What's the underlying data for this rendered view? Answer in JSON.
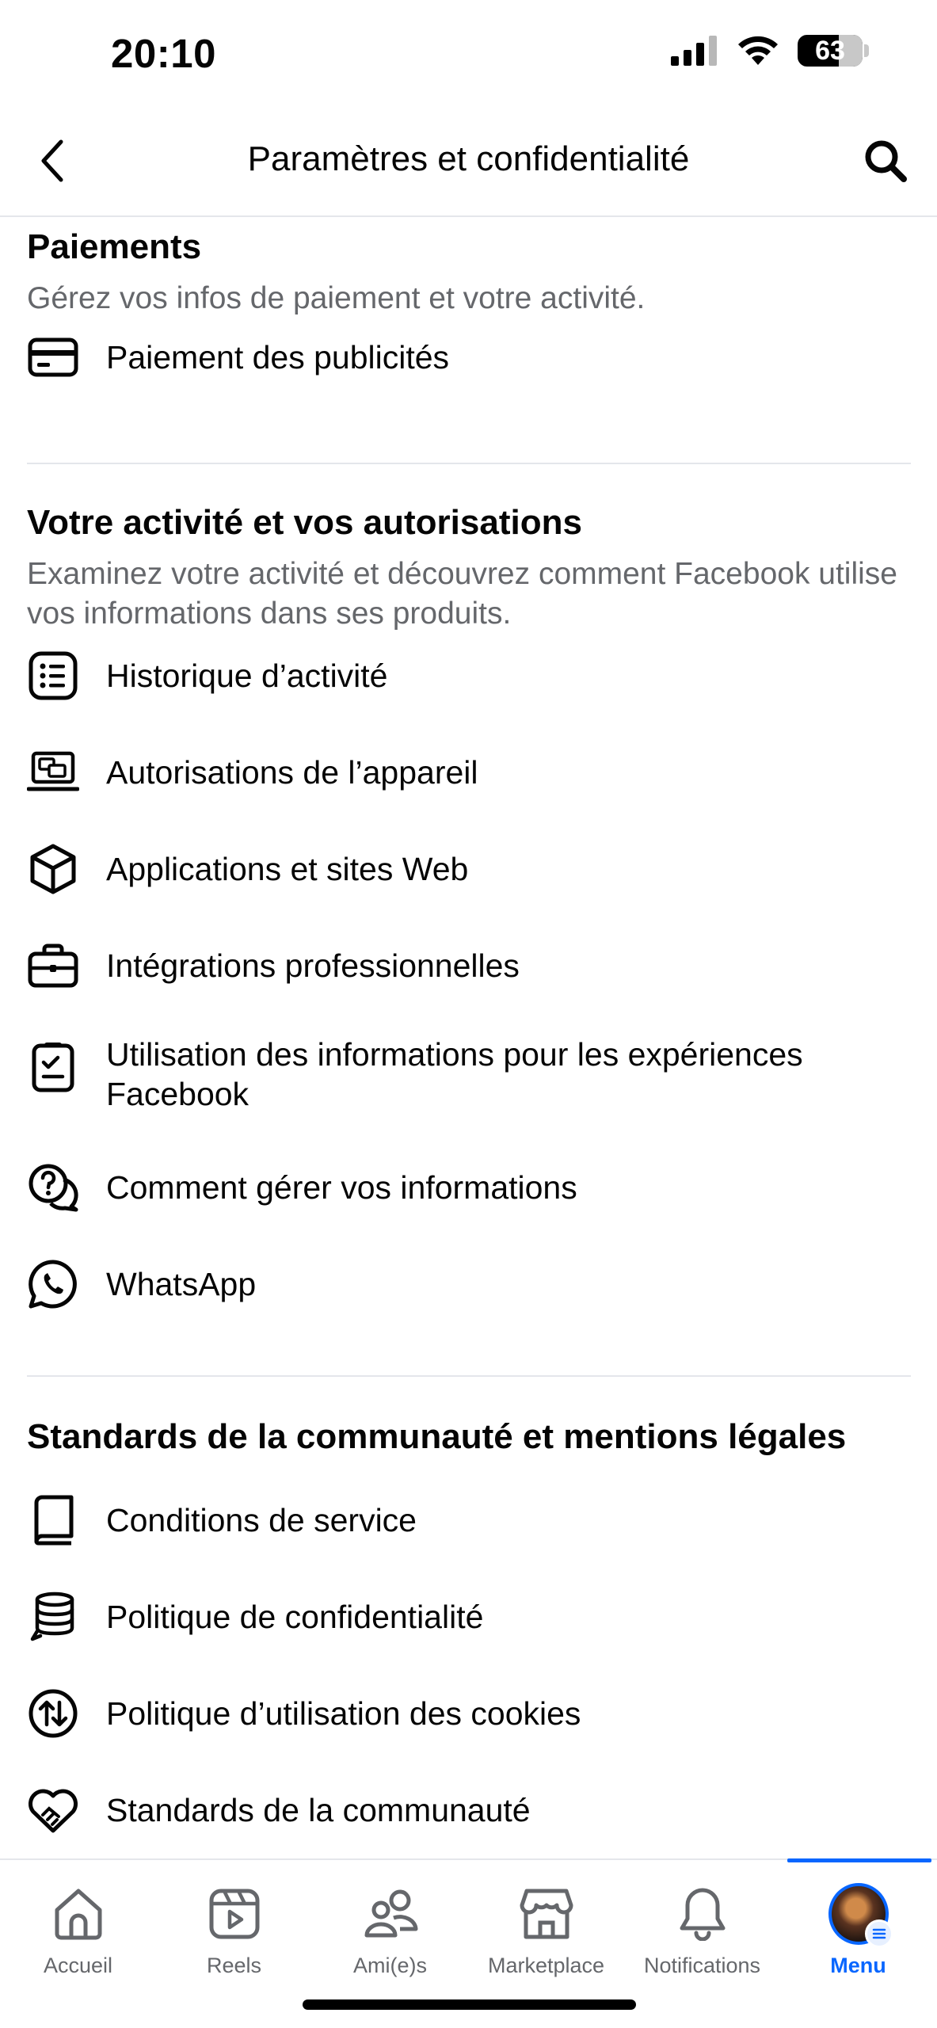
{
  "status_bar": {
    "time": "20:10",
    "battery": "63"
  },
  "header": {
    "title": "Paramètres et confidentialité"
  },
  "sections": {
    "payments": {
      "title": "Paiements",
      "description": "Gérez vos infos de paiement et votre activité.",
      "items": [
        {
          "label": "Paiement des publicités",
          "icon": "credit-card-icon"
        }
      ]
    },
    "activity": {
      "title": "Votre activité et vos autorisations",
      "description": "Examinez votre activité et découvrez comment Facebook utilise vos informations dans ses produits.",
      "items": [
        {
          "label": "Historique d’activité",
          "icon": "list-icon"
        },
        {
          "label": "Autorisations de l’appareil",
          "icon": "laptop-icon"
        },
        {
          "label": "Applications et sites Web",
          "icon": "cube-icon"
        },
        {
          "label": "Intégrations professionnelles",
          "icon": "briefcase-icon"
        },
        {
          "label": "Utilisation des informations pour les expériences Facebook",
          "icon": "clipboard-check-icon"
        },
        {
          "label": "Comment gérer vos informations",
          "icon": "question-chat-icon"
        },
        {
          "label": "WhatsApp",
          "icon": "whatsapp-icon"
        }
      ]
    },
    "legal": {
      "title": "Standards de la communauté et mentions légales",
      "items": [
        {
          "label": "Conditions de service",
          "icon": "book-icon"
        },
        {
          "label": "Politique de confidentialité",
          "icon": "database-icon"
        },
        {
          "label": "Politique d’utilisation des cookies",
          "icon": "arrows-circle-icon"
        },
        {
          "label": "Standards de la communauté",
          "icon": "handshake-heart-icon"
        }
      ]
    }
  },
  "tab_bar": {
    "tabs": [
      {
        "label": "Accueil",
        "icon": "home-icon"
      },
      {
        "label": "Reels",
        "icon": "reels-icon"
      },
      {
        "label": "Ami(e)s",
        "icon": "friends-icon"
      },
      {
        "label": "Marketplace",
        "icon": "marketplace-icon"
      },
      {
        "label": "Notifications",
        "icon": "bell-icon"
      },
      {
        "label": "Menu",
        "icon": "avatar"
      }
    ],
    "active": "Menu"
  },
  "colors": {
    "accent": "#0866ff",
    "secondary_text": "#65676b",
    "divider": "#e4e6eb"
  }
}
